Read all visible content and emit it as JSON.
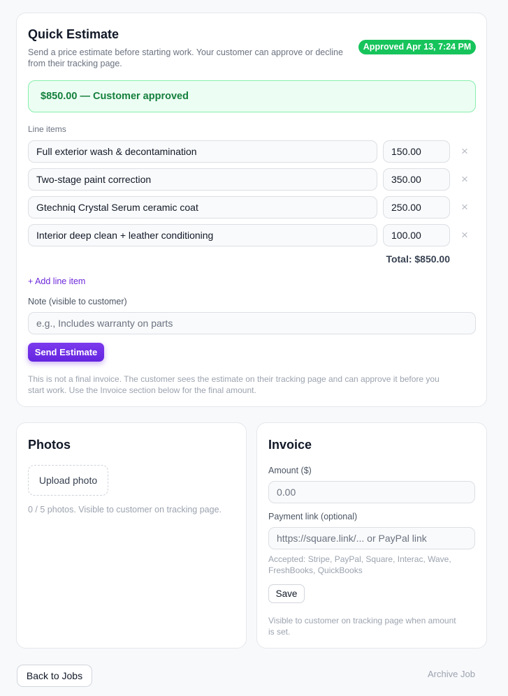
{
  "estimate": {
    "title": "Quick Estimate",
    "subtitle_line1": "Send a price estimate before starting work. Your customer can approve or decline",
    "subtitle_line2": "from their tracking page.",
    "badge": "Approved Apr 13, 7:24 PM",
    "approved_banner": "$850.00 — Customer approved",
    "line_items_label": "Line items",
    "line_items": [
      {
        "description": "Full exterior wash & decontamination",
        "price": "150.00"
      },
      {
        "description": "Two-stage paint correction",
        "price": "350.00"
      },
      {
        "description": "Gtechniq Crystal Serum ceramic coat",
        "price": "250.00"
      },
      {
        "description": "Interior deep clean + leather conditioning",
        "price": "100.00"
      }
    ],
    "remove_glyph": "×",
    "total": "Total: $850.00",
    "add_line_item": "+ Add line item",
    "note_label": "Note (visible to customer)",
    "note_placeholder": "e.g., Includes warranty on parts",
    "send_button": "Send Estimate",
    "footnote_line1": "This is not a final invoice. The customer sees the estimate on their tracking page and can approve it before you",
    "footnote_line2": "start work. Use the Invoice section below for the final amount."
  },
  "photos": {
    "title": "Photos",
    "upload_button": "Upload photo",
    "hint": "0 / 5 photos. Visible to customer on tracking page."
  },
  "invoice": {
    "title": "Invoice",
    "amount_label": "Amount ($)",
    "amount_placeholder": "0.00",
    "payment_label": "Payment link (optional)",
    "payment_placeholder": "https://square.link/... or PayPal link",
    "accepted_line1": "Accepted: Stripe, PayPal, Square, Interac, Wave,",
    "accepted_line2": "FreshBooks, QuickBooks",
    "save_button": "Save",
    "visibility_line1": "Visible to customer on tracking page when amount",
    "visibility_line2": "is set."
  },
  "footer": {
    "back_button": "Back to Jobs",
    "archive_link": "Archive Job"
  },
  "colors": {
    "accent": "#6d28d9",
    "success": "#16c45b",
    "success_text": "#15803d"
  }
}
